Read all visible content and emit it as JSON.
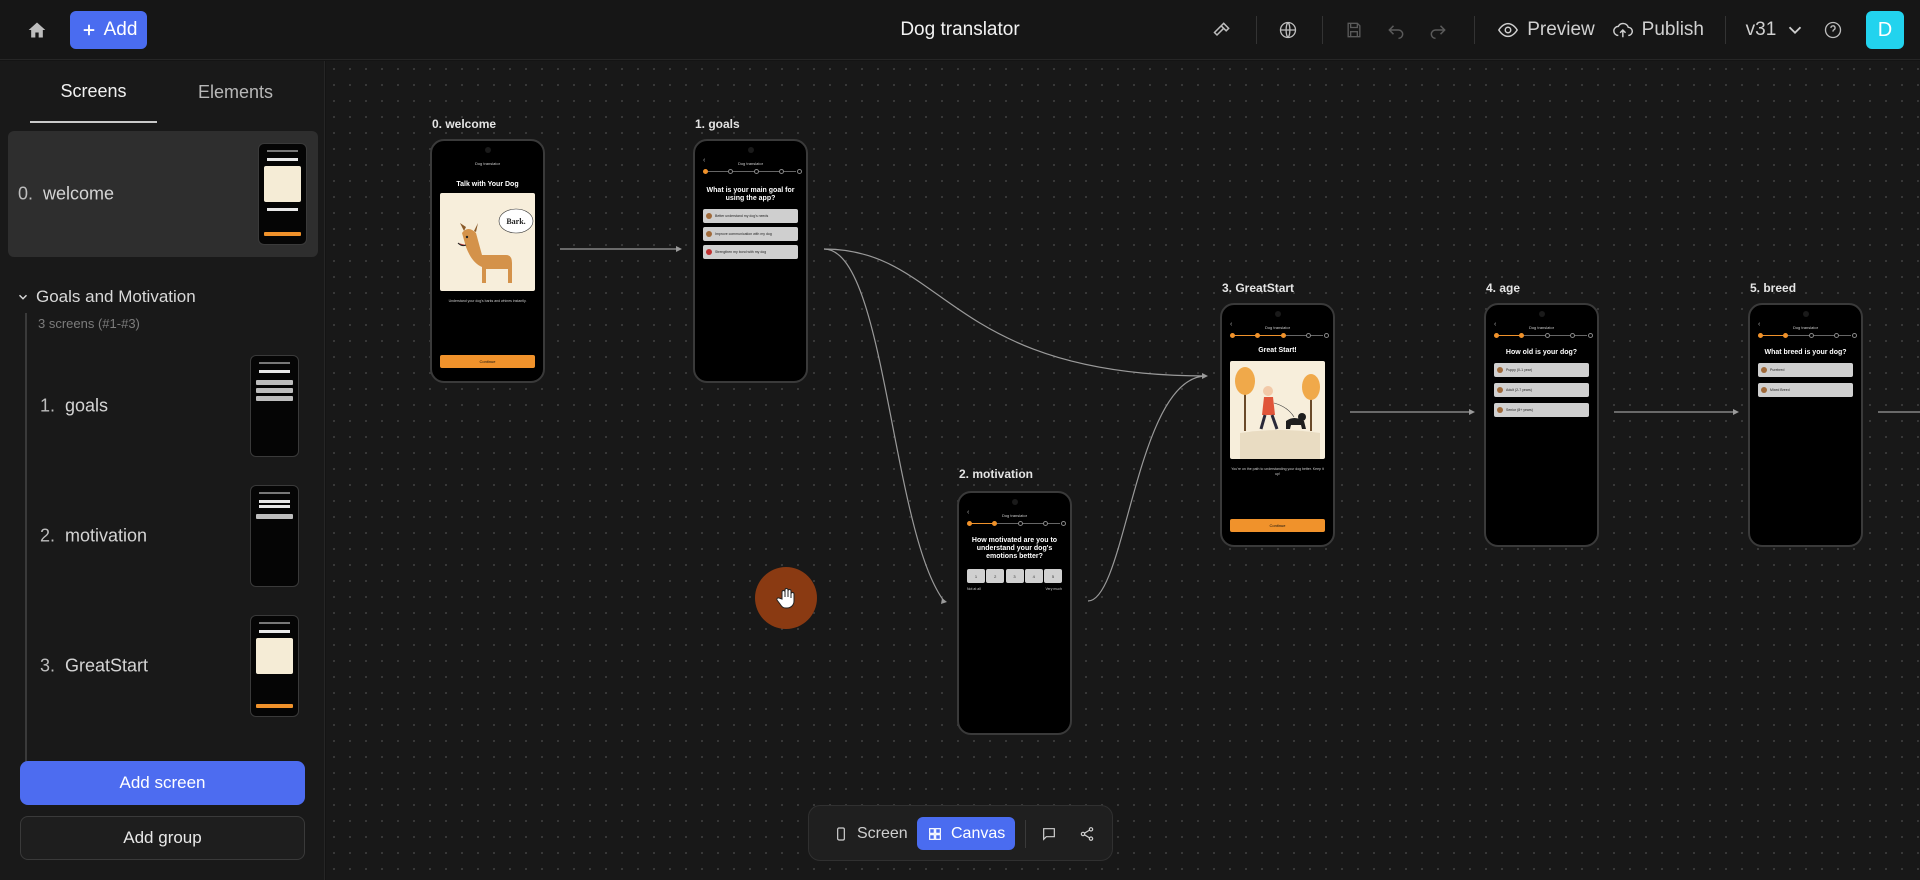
{
  "topbar": {
    "add_label": "Add",
    "title": "Dog translator",
    "preview_label": "Preview",
    "publish_label": "Publish",
    "version": "v31",
    "avatar_initial": "D",
    "icons": [
      "home-icon",
      "plus-icon",
      "hammer-icon",
      "globe-icon",
      "save-icon",
      "undo-icon",
      "redo-icon",
      "eye-icon",
      "cloud-upload-icon",
      "chevron-down-icon",
      "help-icon"
    ]
  },
  "sidebar": {
    "tabs": [
      "Screens",
      "Elements"
    ],
    "active_tab": "Screens",
    "welcome": {
      "num": "0.",
      "name": "welcome"
    },
    "group": {
      "name": "Goals and Motivation",
      "subtitle": "3 screens (#1-#3)"
    },
    "group_items": [
      {
        "num": "1.",
        "name": "goals"
      },
      {
        "num": "2.",
        "name": "motivation"
      },
      {
        "num": "3.",
        "name": "GreatStart"
      }
    ],
    "add_screen_label": "Add screen",
    "add_group_label": "Add group"
  },
  "canvas": {
    "nodes": [
      {
        "label": "0. welcome",
        "app": "Dog translator",
        "heading": "Talk with Your Dog",
        "speech": "Bark.",
        "caption": "Understand your dog's barks and whines instantly.",
        "cta": "Continue"
      },
      {
        "label": "1. goals",
        "app": "Dog translator",
        "question": "What is your main goal for using the app?",
        "options": [
          "Better understand my dog's needs",
          "Improve communication with my dog",
          "Strengthen my bond with my dog"
        ]
      },
      {
        "label": "2. motivation",
        "app": "Dog translator",
        "question": "How motivated are you to understand your dog's emotions better?",
        "scale": [
          "1",
          "2",
          "3",
          "4",
          "5"
        ],
        "low": "Not at all",
        "high": "Very much"
      },
      {
        "label": "3. GreatStart",
        "app": "Dog translator",
        "heading": "Great Start!",
        "caption": "You're on the path to understanding your dog better. Keep it up!",
        "cta": "Continue"
      },
      {
        "label": "4. age",
        "app": "Dog translator",
        "question": "How old is your dog?",
        "options": [
          "Puppy (0-1 year)",
          "Adult (2-7 years)",
          "Senior (8+ years)"
        ]
      },
      {
        "label": "5. breed",
        "app": "Dog translator",
        "question": "What breed is your dog?",
        "options": [
          "Purebred",
          "Mixed Breed"
        ]
      }
    ]
  },
  "bottom_toolbar": {
    "screen_label": "Screen",
    "canvas_label": "Canvas",
    "active_mode": "Canvas"
  },
  "colors": {
    "accent": "#4a6cf0",
    "cta": "#f0922b",
    "avatar": "#22d3ee"
  }
}
